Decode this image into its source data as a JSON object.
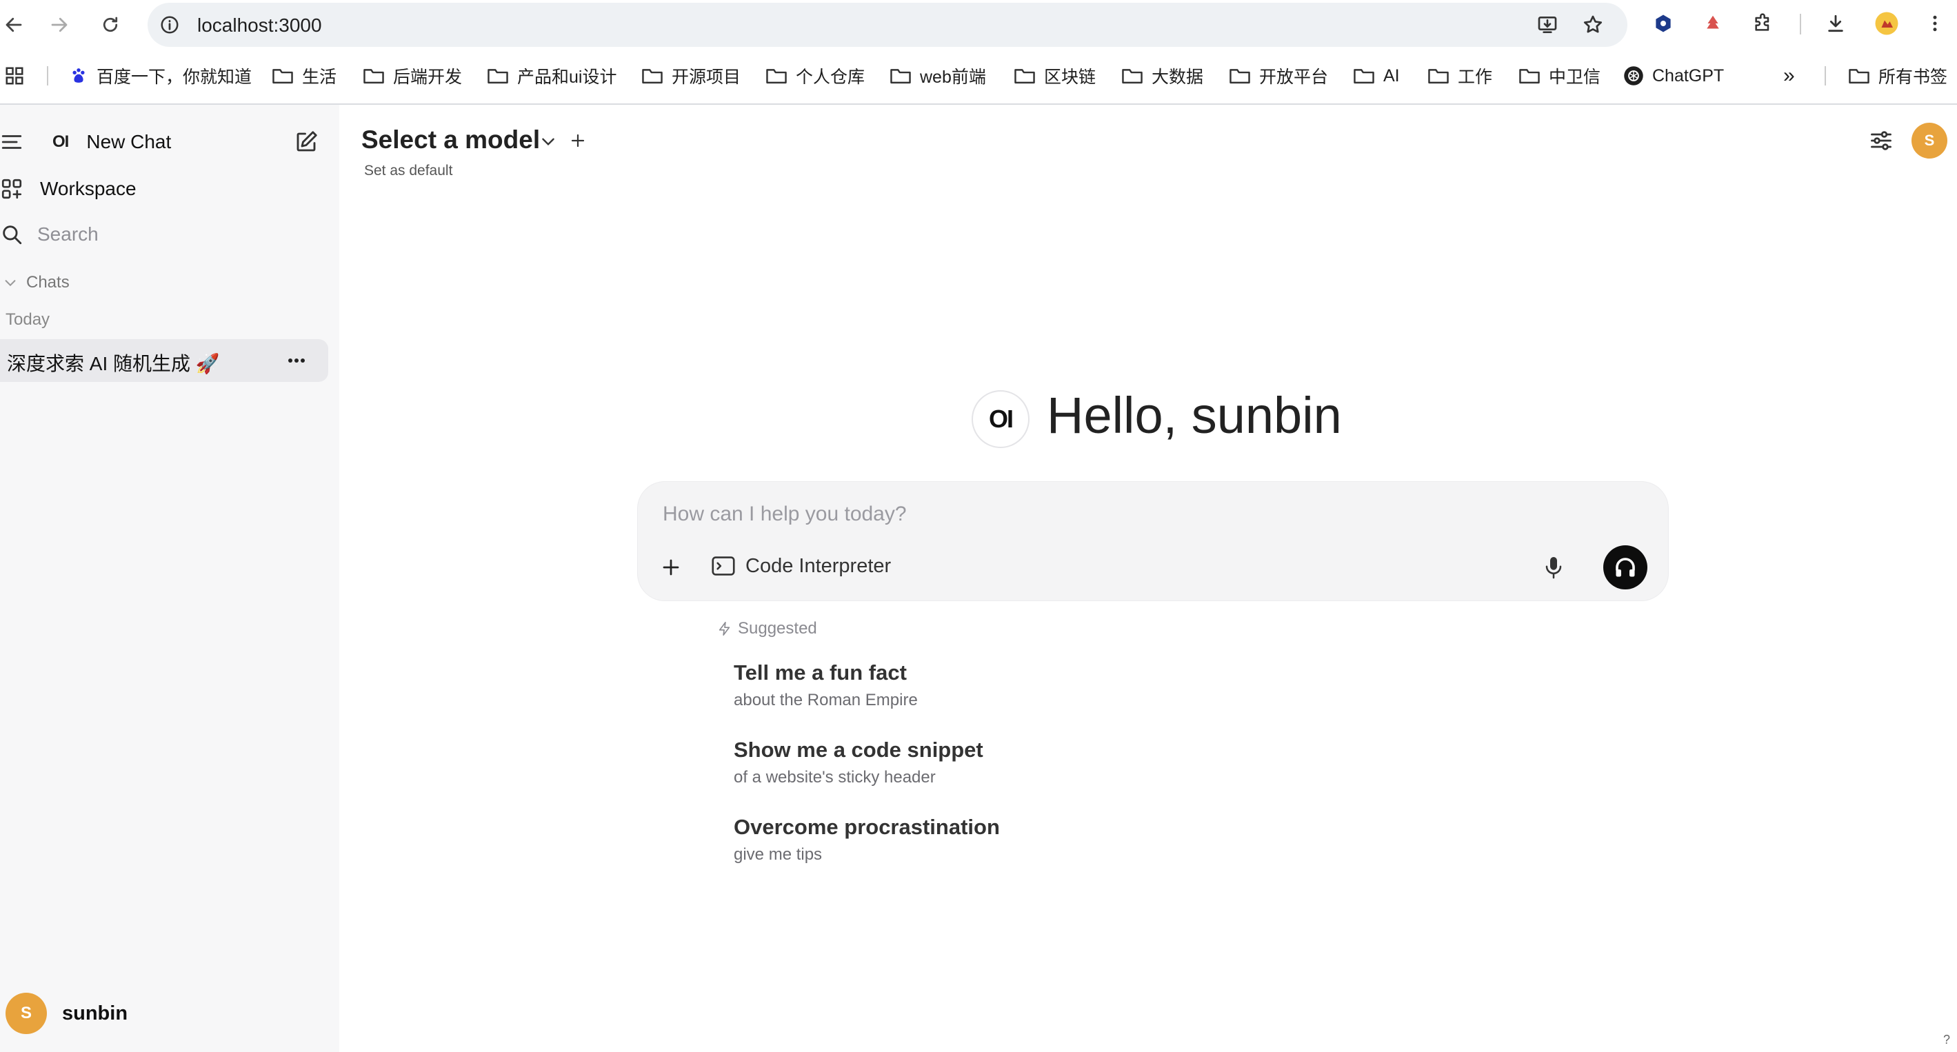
{
  "browser": {
    "url": "localhost:3000",
    "bookmarks": [
      {
        "label": "百度一下，你就知道",
        "icon": "baidu-icon"
      },
      {
        "label": "生活",
        "icon": "folder-icon"
      },
      {
        "label": "后端开发",
        "icon": "folder-icon"
      },
      {
        "label": "产品和ui设计",
        "icon": "folder-icon"
      },
      {
        "label": "开源项目",
        "icon": "folder-icon"
      },
      {
        "label": "个人仓库",
        "icon": "folder-icon"
      },
      {
        "label": "web前端",
        "icon": "folder-icon"
      },
      {
        "label": "区块链",
        "icon": "folder-icon"
      },
      {
        "label": "大数据",
        "icon": "folder-icon"
      },
      {
        "label": "开放平台",
        "icon": "folder-icon"
      },
      {
        "label": "AI",
        "icon": "folder-icon"
      },
      {
        "label": "工作",
        "icon": "folder-icon"
      },
      {
        "label": "中卫信",
        "icon": "folder-icon"
      },
      {
        "label": "ChatGPT",
        "icon": "chatgpt-icon"
      }
    ],
    "overflow_label": "»",
    "all_bookmarks_label": "所有书签"
  },
  "sidebar": {
    "logo_text": "OI",
    "new_chat_label": "New Chat",
    "workspace_label": "Workspace",
    "search_placeholder": "Search",
    "chats_section_label": "Chats",
    "today_label": "Today",
    "chats": [
      {
        "title": "深度求索 AI 随机生成 🚀"
      }
    ],
    "user": {
      "initial": "S",
      "name": "sunbin"
    }
  },
  "header": {
    "model_title": "Select a model",
    "set_default_label": "Set as default",
    "user_initial": "S"
  },
  "main": {
    "logo_text": "OI",
    "greeting": "Hello, sunbin",
    "input_placeholder": "How can I help you today?",
    "code_interpreter_label": "Code Interpreter",
    "suggested_label": "Suggested",
    "suggestions": [
      {
        "title": "Tell me a fun fact",
        "subtitle": "about the Roman Empire"
      },
      {
        "title": "Show me a code snippet",
        "subtitle": "of a website's sticky header"
      },
      {
        "title": "Overcome procrastination",
        "subtitle": "give me tips"
      }
    ],
    "help_mark": "?"
  },
  "colors": {
    "avatar": "#e8a33d",
    "sidebar_bg": "#f7f7f8",
    "selected_chat_bg": "#e9e9ec",
    "omnibox_bg": "#eef1f4",
    "voice_button": "#0d0d0d"
  }
}
